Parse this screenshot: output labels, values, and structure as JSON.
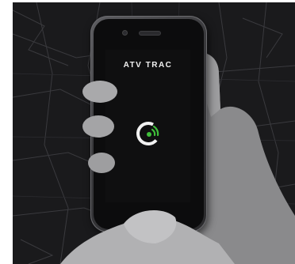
{
  "app": {
    "brand_name": "ATV TRAC",
    "logo_icon": "location-signal-icon"
  },
  "colors": {
    "accent_green": "#3fbf3a",
    "screen_bg": "#0f0f10",
    "map_bg": "#1a1a1c",
    "map_lines": "#3a3a3e"
  }
}
